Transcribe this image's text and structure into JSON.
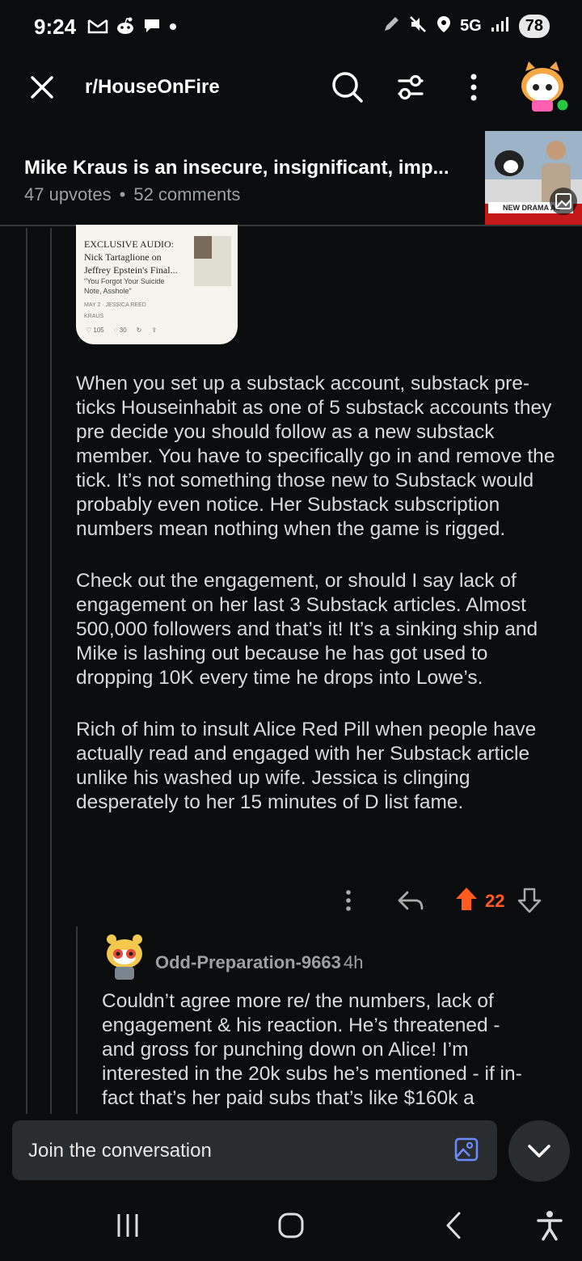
{
  "status_bar": {
    "time": "9:24",
    "network": "5G",
    "battery": "78"
  },
  "header": {
    "subreddit": "r/HouseOnFire"
  },
  "post": {
    "title": "Mike Kraus is an insecure, insignificant, imp...",
    "upvotes": "47 upvotes",
    "separator": "•",
    "comments": "52 comments",
    "thumbnail_caption": "NEW DRAMA AL"
  },
  "embed": {
    "title": "EXCLUSIVE AUDIO: Nick Tartaglione on Jeffrey Epstein's Final...",
    "subtitle": "\"You Forgot Your Suicide Note, Asshole\"",
    "meta": "MAY 2 · JESSICA REED",
    "meta2": "KRAUS",
    "likes": "105",
    "comments": "30"
  },
  "comment": {
    "paragraphs": [
      "When you set up a substack account, substack pre-ticks Houseinhabit as one of 5 substack accounts they pre decide you should follow as a new substack member. You have to specifically go in and remove the tick. It’s not something those new to Substack would probably even notice. Her Substack subscription numbers mean nothing when the game is rigged.",
      "Check out the engagement, or should I say lack of engagement on her last 3 Substack articles. Almost 500,000 followers and that’s it! It’s a sinking ship and Mike is lashing out because he has got used to dropping 10K every time he drops into Lowe’s.",
      "Rich of him to insult Alice Red Pill when people have actually read and engaged with her Substack article unlike his washed up wife. Jessica is clinging desperately to her 15 minutes of D list fame."
    ],
    "votes": "22"
  },
  "reply": {
    "username": "Odd-Preparation-9663",
    "time": "4h",
    "body": "Couldn’t agree more re/ the numbers, lack of engagement & his reaction. He’s threatened - and gross for punching down on Alice! I’m interested in the 20k subs he’s mentioned - if in-fact that’s her paid subs that’s like $160k a"
  },
  "composer": {
    "placeholder": "Join the conversation"
  },
  "colors": {
    "background": "#0b0c0d",
    "upvote_active": "#ff5a1f",
    "composer_bg": "#2a2d30",
    "image_icon": "#6b8cff"
  }
}
